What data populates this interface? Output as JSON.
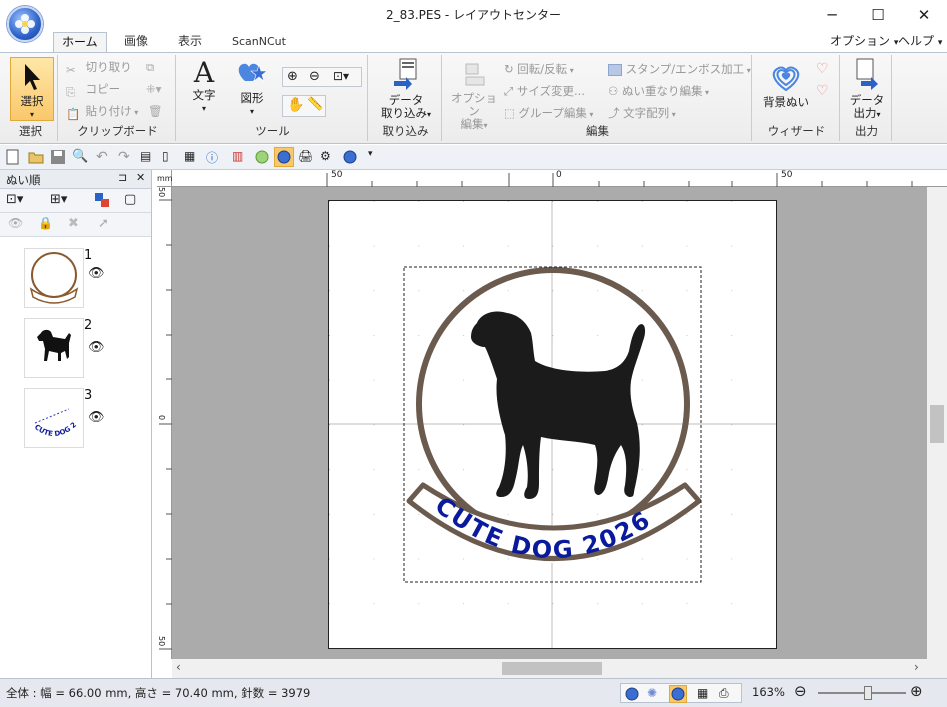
{
  "window": {
    "title": "2_83.PES - レイアウトセンター",
    "minimize": "─",
    "maximize": "☐",
    "close": "✕"
  },
  "tabs": [
    "ホーム",
    "画像",
    "表示",
    "ScanNCut"
  ],
  "menu_right": {
    "options": "オプション",
    "help": "ヘルプ"
  },
  "ribbon": {
    "select_group": {
      "label": "選択",
      "button": "選択"
    },
    "clipboard_group": {
      "label": "クリップボード",
      "cut": "切り取り",
      "copy": "コピー",
      "paste": "貼り付け"
    },
    "tools_group": {
      "label": "ツール",
      "text": "文字",
      "shape": "図形"
    },
    "import_group": {
      "label": "取り込み",
      "button_line1": "データ",
      "button_line2": "取り込み"
    },
    "edit_group": {
      "label": "編集",
      "options_line1": "オプション",
      "options_line2": "編集",
      "rotate": "回転/反転",
      "resize": "サイズ変更...",
      "group_edit": "グループ編集",
      "stamp": "スタンプ/エンボス加工",
      "overlap": "ぬい重なり編集",
      "text_arrange": "文字配列"
    },
    "wizard_group": {
      "label": "ウィザード",
      "button": "背景ぬい"
    },
    "output_group": {
      "label": "出力",
      "button_line1": "データ",
      "button_line2": "出力"
    }
  },
  "left_panel": {
    "title": "ぬい順",
    "pin": "ᵖ",
    "close": "✕",
    "items": [
      {
        "number": "1",
        "name": "frame"
      },
      {
        "number": "2",
        "name": "dog"
      },
      {
        "number": "3",
        "name": "text"
      }
    ]
  },
  "rulers": {
    "top_labels": [
      "50",
      "0",
      "50"
    ],
    "left_labels": [
      "50",
      "0",
      "50"
    ],
    "unit": "mm"
  },
  "design": {
    "banner_text": "CUTE DOG 2026",
    "thumb_text": "CUTE DOG 2026",
    "frame_color": "#6b5a4e",
    "text_color": "#0a1a9c",
    "dog_color": "#111111"
  },
  "status": {
    "info": "全体 : 幅 = 66.00 mm, 高さ = 70.40 mm, 針数 = 3979",
    "zoom": "163%"
  },
  "colors": {
    "accent": "#2e62c9",
    "selected_button": "#f9c86b",
    "canvas_bg": "#ababab"
  }
}
